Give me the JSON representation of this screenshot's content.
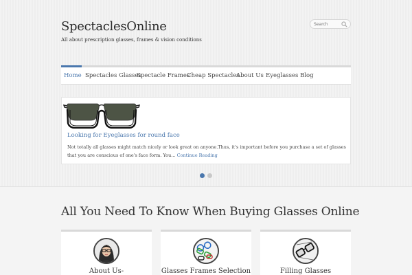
{
  "header": {
    "site_title": "SpectaclesOnline",
    "tagline": "All about prescription glasses, frames & vision conditions",
    "search_placeholder": "Search"
  },
  "nav": {
    "items": [
      {
        "label": "Home",
        "active": true
      },
      {
        "label": "Spectacles Glasses"
      },
      {
        "label": "Spectacle Frames"
      },
      {
        "label": "Cheap Spectacles"
      },
      {
        "label": "About Us"
      },
      {
        "label": "Eyeglasses Blog"
      }
    ]
  },
  "slider": {
    "post_title": "Looking for Eyeglasses for round face",
    "excerpt": "Not totally all glasses might match nicely or look great on anyone.Thus, it's important before you purchase a set of glasses that you are conscious of one's face form. You...",
    "continue_label": "Continue Reading",
    "image_icon": "eyeglasses-icon",
    "active_slide": 1,
    "slide_count": 2
  },
  "section": {
    "heading": "All You Need To Know When Buying Glasses Online",
    "features": [
      {
        "label": "About Us-",
        "icon": "woman-with-glasses-icon"
      },
      {
        "label": "Glasses Frames Selection",
        "icon": "glasses-frames-icon"
      },
      {
        "label": "Filling Glasses",
        "icon": "glasses-filling-icon"
      }
    ]
  },
  "colors": {
    "accent": "#4a77ad",
    "text": "#333333",
    "background": "#f4f4f4"
  }
}
